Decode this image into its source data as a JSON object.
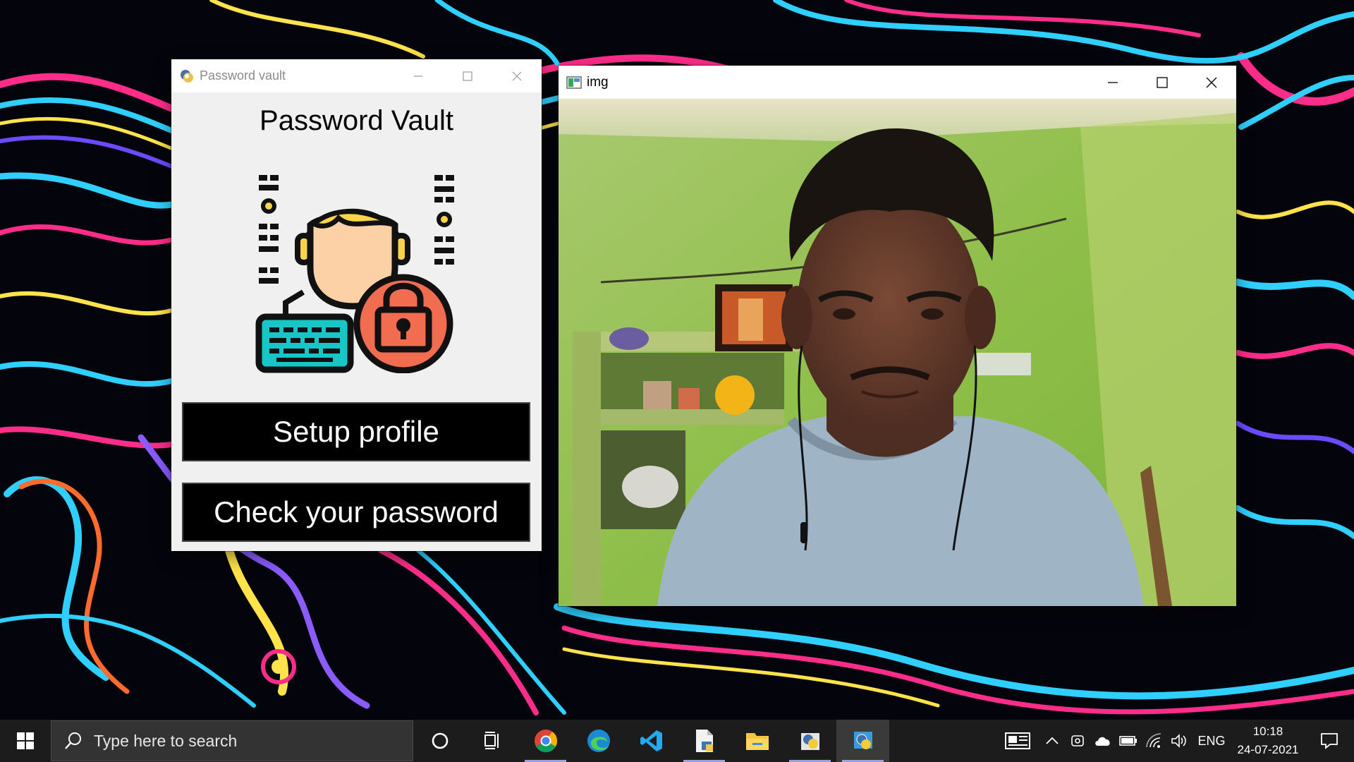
{
  "vault_window": {
    "title": "Password vault",
    "heading": "Password Vault",
    "setup_button": "Setup profile",
    "check_button": "Check your password"
  },
  "img_window": {
    "title": "img"
  },
  "taskbar": {
    "search_placeholder": "Type here to search",
    "apps": [
      "cortana-icon",
      "task-view-icon",
      "chrome-icon",
      "edge-icon",
      "vscode-icon",
      "file-icon",
      "file-explorer-icon",
      "python-idle-icon",
      "python-app-icon"
    ],
    "language": "ENG",
    "time": "10:18",
    "date": "24-07-2021"
  },
  "colors": {
    "taskbar_bg": "#1c1c1c",
    "vault_bg": "#f0f0f0",
    "button_bg": "#000000",
    "keyboard_teal": "#18c6c8",
    "lock_orange": "#f26d4f",
    "hair_yellow": "#f9d44a",
    "face_skin": "#fcd1a6"
  }
}
